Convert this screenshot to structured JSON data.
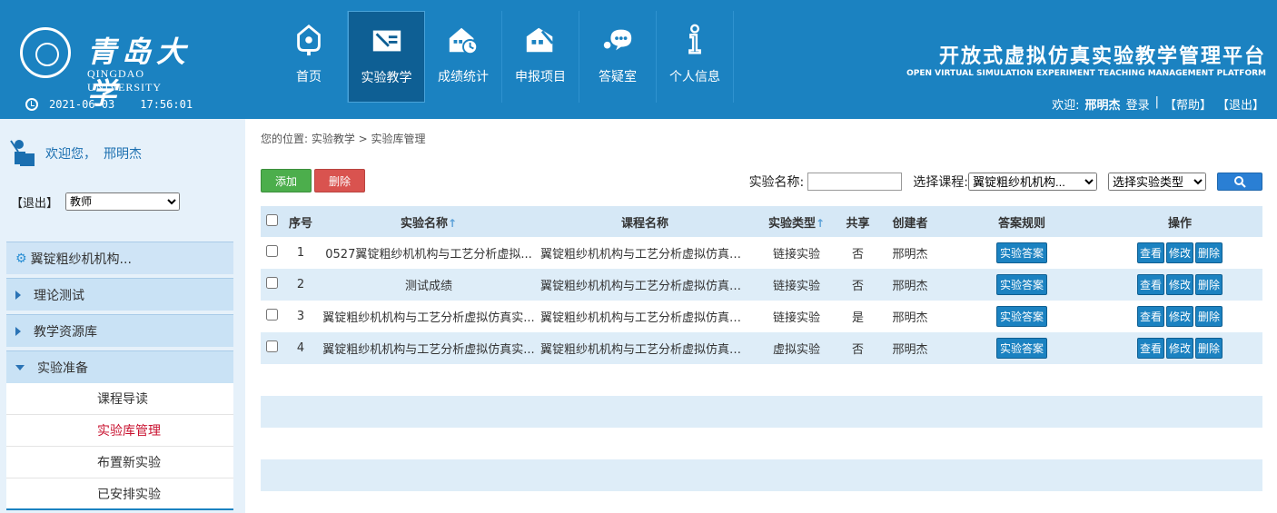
{
  "header": {
    "logo_cn": "青岛大学",
    "logo_en": "QINGDAO UNIVERSITY",
    "date": "2021-06-03",
    "time": "17:56:01",
    "platform_cn": "开放式虚拟仿真实验教学管理平台",
    "platform_en": "OPEN VIRTUAL SIMULATION EXPERIMENT TEACHING MANAGEMENT PLATFORM",
    "welcome_prefix": "欢迎:",
    "user_name": "邢明杰",
    "login_label": "登录",
    "separator": "|",
    "help_label": "【帮助】",
    "exit_label": "【退出】",
    "nav": [
      {
        "label": "首页",
        "icon": "home-icon"
      },
      {
        "label": "实验教学",
        "icon": "teaching-icon"
      },
      {
        "label": "成绩统计",
        "icon": "stats-icon"
      },
      {
        "label": "申报项目",
        "icon": "project-icon"
      },
      {
        "label": "答疑室",
        "icon": "qa-icon"
      },
      {
        "label": "个人信息",
        "icon": "info-icon"
      }
    ]
  },
  "sidebar": {
    "welcome_text": "欢迎您，",
    "user_name": "邢明杰",
    "exit_label": "【退出】",
    "role_selected": "教师",
    "course_label": "翼锭粗纱机机构...",
    "menus": [
      {
        "label": "理论测试"
      },
      {
        "label": "教学资源库"
      },
      {
        "label": "实验准备"
      }
    ],
    "sub_items": [
      {
        "label": "课程导读"
      },
      {
        "label": "实验库管理"
      },
      {
        "label": "布置新实验"
      },
      {
        "label": "已安排实验"
      }
    ]
  },
  "main": {
    "breadcrumb": "您的位置: 实验教学 > 实验库管理",
    "add_label": "添加",
    "delete_label": "删除",
    "filter_name_label": "实验名称:",
    "filter_name_value": "",
    "filter_course_label": "选择课程:",
    "filter_course_value": "翼锭粗纱机机构...",
    "filter_type_value": "选择实验类型",
    "columns": [
      "序号",
      "实验名称",
      "课程名称",
      "实验类型",
      "共享",
      "创建者",
      "答案规则",
      "操作"
    ],
    "sort_arrow": "↑",
    "answer_btn": "实验答案",
    "view_btn": "查看",
    "edit_btn": "修改",
    "del_btn": "删除",
    "rows": [
      {
        "no": "1",
        "name": "0527翼锭粗纱机机构与工艺分析虚拟...",
        "course": "翼锭粗纱机机构与工艺分析虚拟仿真实...",
        "type": "链接实验",
        "share": "否",
        "creator": "邢明杰"
      },
      {
        "no": "2",
        "name": "测试成绩",
        "course": "翼锭粗纱机机构与工艺分析虚拟仿真实...",
        "type": "链接实验",
        "share": "否",
        "creator": "邢明杰"
      },
      {
        "no": "3",
        "name": "翼锭粗纱机机构与工艺分析虚拟仿真实...",
        "course": "翼锭粗纱机机构与工艺分析虚拟仿真实...",
        "type": "链接实验",
        "share": "是",
        "creator": "邢明杰"
      },
      {
        "no": "4",
        "name": "翼锭粗纱机机构与工艺分析虚拟仿真实...",
        "course": "翼锭粗纱机机构与工艺分析虚拟仿真实...",
        "type": "虚拟实验",
        "share": "否",
        "creator": "邢明杰"
      }
    ]
  },
  "colors": {
    "header_bg": "#1b82c1",
    "active_nav": "#0e5f94",
    "add_green": "#4cae4c",
    "delete_red": "#d9534f",
    "active_text": "#c8102e",
    "row_alt": "#deedf8"
  }
}
